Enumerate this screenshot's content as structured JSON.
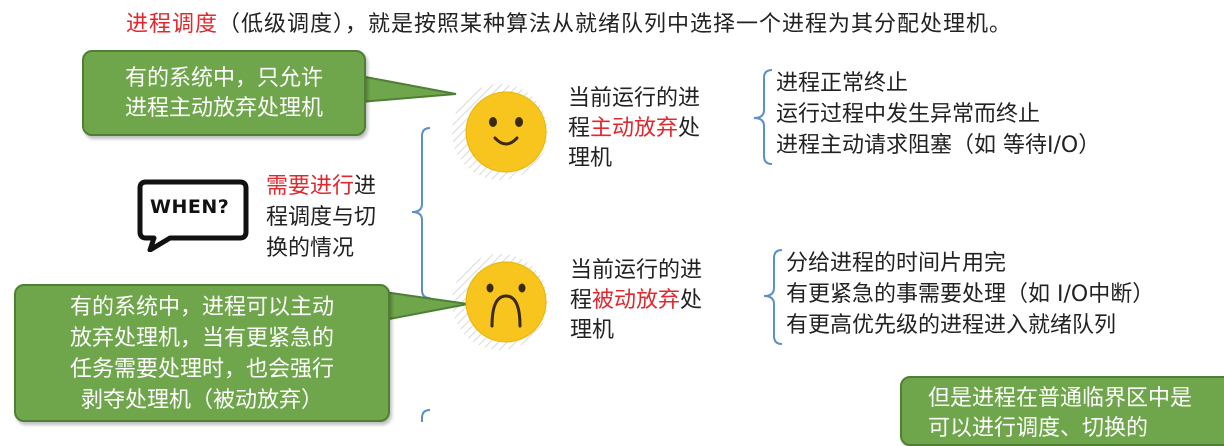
{
  "header": {
    "term": "进程调度",
    "rest": "（低级调度），就是按照某种算法从就绪队列中选择一个进程为其分配处理机。"
  },
  "callouts": {
    "c1": [
      "有的系统中，只允许",
      "进程主动放弃处理机"
    ],
    "c2": [
      "有的系统中，进程可以主动",
      "放弃处理机，当有更紧急的",
      "任务需要处理时，也会强行",
      "剥夺处理机（被动放弃）"
    ],
    "c3": [
      "但是进程在普通临界区中是",
      "可以进行调度、切换的"
    ]
  },
  "when": {
    "badge": "WHEN?",
    "needs_red": "需要进行",
    "needs_line1_rest": "进",
    "needs_line2": "程调度与切",
    "needs_line3": "换的情况"
  },
  "branches": {
    "active": {
      "line1": "当前运行的进",
      "prefix": "程",
      "red": "主动放弃",
      "suffix": "处",
      "line3": "理机",
      "items": [
        "进程正常终止",
        "运行过程中发生异常而终止",
        "进程主动请求阻塞（如 等待I/O）"
      ]
    },
    "passive": {
      "line1": "当前运行的进",
      "prefix": "程",
      "red": "被动放弃",
      "suffix": "处",
      "line3": "理机",
      "items": [
        "分给进程的时间片用完",
        "有更紧急的事需要处理（如 I/O中断）",
        "有更高优先级的进程进入就绪队列"
      ]
    }
  },
  "colors": {
    "accent_red": "#e0282e",
    "callout_green": "#6fa64b",
    "bracket_blue": "#5b8fc7",
    "face_yellow": "#f7c51e"
  }
}
